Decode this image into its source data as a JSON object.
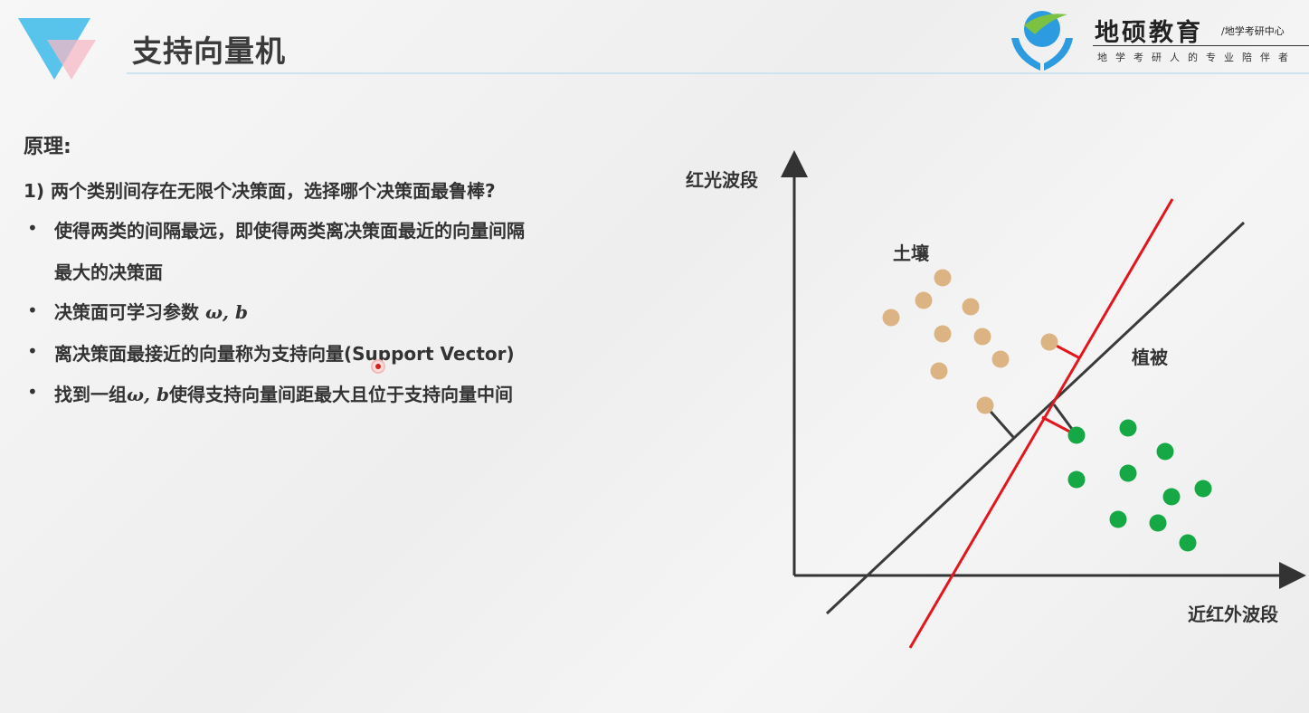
{
  "header": {
    "title": "支持向量机",
    "brand_name": "地硕教育",
    "brand_tagline": "/地学考研中心",
    "brand_slogan": "地学考研人的专业陪伴者"
  },
  "content": {
    "section_label": "原理:",
    "question": "1) 两个类别间存在无限个决策面，选择哪个决策面最鲁棒?",
    "bullets": [
      {
        "line1": "使得两类的间隔最远，即使得两类离决策面最近的向量间隔",
        "line2": "最大的决策面"
      },
      {
        "text": "决策面可学习参数 ",
        "math": "ω, b"
      },
      {
        "text": "离决策面最接近的向量称为支持向量(Support Vector)"
      },
      {
        "pre": "找到一组",
        "math": "ω, b",
        "post": "使得支持向量间距最大且位于支持向量中间"
      }
    ],
    "bullet_symbol": "•"
  },
  "diagram": {
    "y_axis_label": "红光波段",
    "x_axis_label": "近红外波段",
    "class_soil_label": "土壤",
    "class_vegetation_label": "植被",
    "colors": {
      "soil": "#dcb483",
      "vegetation": "#16a845",
      "optimal_line": "#3a3a3a",
      "other_line": "#e3161c",
      "margin_red": "#e3161c",
      "axis": "#333333"
    },
    "soil_count": 11,
    "vegetation_count": 11
  },
  "icons": {
    "logo": "triangle-logo-icon",
    "brand": "hands-globe-logo-icon",
    "cursor": "laser-pointer-icon"
  }
}
